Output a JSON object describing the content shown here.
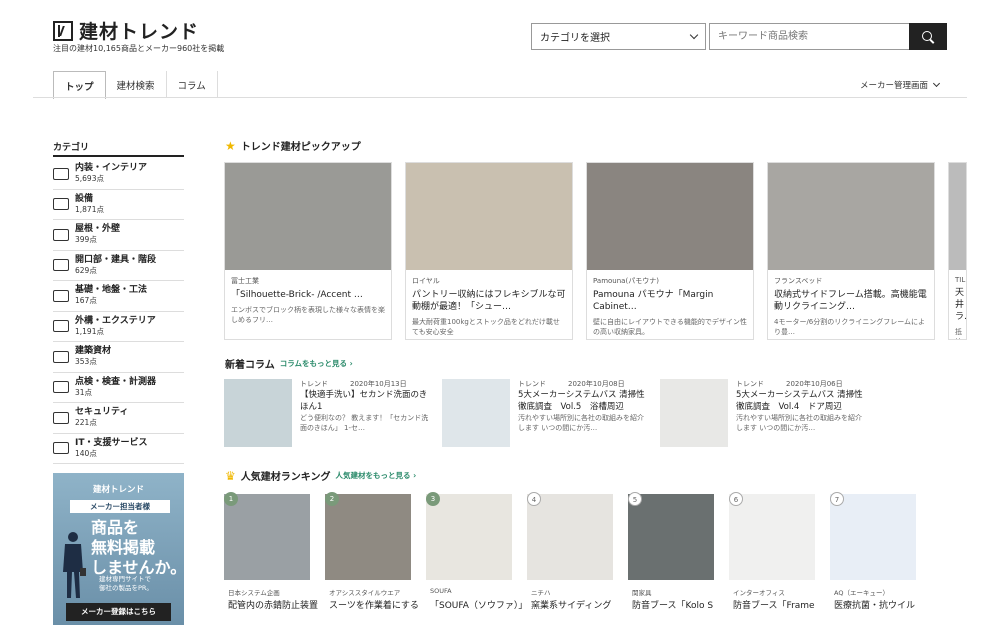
{
  "header": {
    "logo": "建材トレンド",
    "tagline": "注目の建材10,165商品とメーカー960社を掲載",
    "category_select": "カテゴリを選択",
    "search_placeholder": "キーワード商品検索"
  },
  "tabs": [
    "トップ",
    "建材検索",
    "コラム"
  ],
  "admin_link": "メーカー管理画面",
  "categories": {
    "title": "カテゴリ",
    "items": [
      {
        "label": "内装・インテリア",
        "count": "5,693点"
      },
      {
        "label": "設備",
        "count": "1,871点"
      },
      {
        "label": "屋根・外壁",
        "count": "399点"
      },
      {
        "label": "開口部・建具・階段",
        "count": "629点"
      },
      {
        "label": "基礎・地盤・工法",
        "count": "167点"
      },
      {
        "label": "外構・エクステリア",
        "count": "1,191点"
      },
      {
        "label": "建築資材",
        "count": "353点"
      },
      {
        "label": "点検・検査・計測器",
        "count": "31点"
      },
      {
        "label": "セキュリティ",
        "count": "221点"
      },
      {
        "label": "IT・支援サービス",
        "count": "140点"
      }
    ]
  },
  "banner": {
    "logo": "建材トレンド",
    "tag": "メーカー担当者様",
    "headline": "商品を\n無料掲載\nしませんか。",
    "sub": "建材専門サイトで\n御社の製品をPR。",
    "button": "メーカー登録はこちら"
  },
  "pickup": {
    "title": "トレンド建材ピックアップ",
    "cards": [
      {
        "source": "冨士工業",
        "title": "「Silhouette-Brick- /Accent …",
        "desc": "エンボスでブロック柄を表現した様々な表情を楽しめるフリ…",
        "color": "#9a9a96"
      },
      {
        "source": "ロイヤル",
        "title": "パントリー収納にはフレキシブルな可動棚が最適！「シュー…",
        "desc": "最大耐荷重100kgとストック品をどれだけ載せても安心安全",
        "color": "#c9c0b0"
      },
      {
        "source": "Pamouna(パモウナ)",
        "title": "Pamouna パモウナ「Margin Cabinet…",
        "desc": "壁に自由にレイアウトできる機能的でデザイン性の高い収納家具。",
        "color": "#8a8580"
      },
      {
        "source": "フランスベッド",
        "title": "収納式サイドフレーム搭載。高機能電動リクライニング…",
        "desc": "4モーター/6分割のリクライニングフレームにより豊…",
        "color": "#a8a6a2"
      },
      {
        "source": "TIL",
        "title": "天井ラ…",
        "desc": "抵抗…",
        "color": "#bbb"
      }
    ]
  },
  "columns": {
    "title": "新着コラム",
    "more": "コラムをもっと見る",
    "items": [
      {
        "tag": "トレンド",
        "date": "2020年10月13日",
        "title": "【快適手洗い】セカンド洗面のきほん1",
        "desc": "どう便利なの？ 教えます！「セカンド洗面のきほん」 1-セ…"
      },
      {
        "tag": "トレンド",
        "date": "2020年10月08日",
        "title": "5大メーカーシステムバス 清掃性徹底調査　Vol.5　浴槽周辺",
        "desc": "汚れやすい場所別に各社の取組みを紹介します いつの間にか汚…"
      },
      {
        "tag": "トレンド",
        "date": "2020年10月06日",
        "title": "5大メーカーシステムバス 清掃性徹底調査　Vol.4　ドア周辺",
        "desc": "汚れやすい場所別に各社の取組みを紹介します いつの間にか汚…"
      }
    ]
  },
  "ranking": {
    "title": "人気建材ランキング",
    "more": "人気建材をもっと見る",
    "items": [
      {
        "no": "1",
        "company": "日本システム企画",
        "title": "配管内の赤錆防止装置"
      },
      {
        "no": "2",
        "company": "オアシススタイルウエア",
        "title": "スーツを作業着にする"
      },
      {
        "no": "3",
        "company": "SOUFA",
        "title": "「SOUFA（ソウファ）」"
      },
      {
        "no": "4",
        "company": "ニチハ",
        "title": "窯業系サイディング"
      },
      {
        "no": "5",
        "company": "関家具",
        "title": "防音ブース「Kolo S"
      },
      {
        "no": "6",
        "company": "インターオフィス",
        "title": "防音ブース「Frame"
      },
      {
        "no": "7",
        "company": "AQ（エーキュー）",
        "title": "医療抗菌・抗ウイル"
      }
    ]
  }
}
